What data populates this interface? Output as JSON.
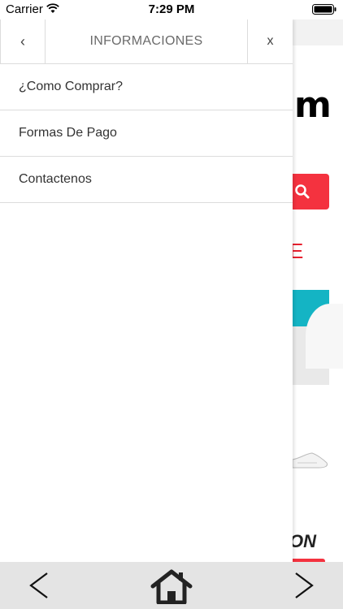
{
  "status_bar": {
    "carrier": "Carrier",
    "time": "7:29 PM",
    "icons": [
      "wifi-icon",
      "battery-icon"
    ]
  },
  "drawer": {
    "back_label": "‹",
    "title": "INFORMACIONES",
    "close_label": "x",
    "items": [
      {
        "label": "¿Como Comprar?"
      },
      {
        "label": "Formas De Pago"
      },
      {
        "label": "Contactenos"
      }
    ]
  },
  "background": {
    "logo_fragment": "m",
    "red_fragment": "E",
    "brand_fragment": "ON",
    "accent_color": "#f4323f",
    "teal_color": "#14b4c4"
  },
  "bottom_bar": {
    "icons": [
      "chevron-left-icon",
      "home-icon",
      "chevron-right-icon"
    ]
  }
}
